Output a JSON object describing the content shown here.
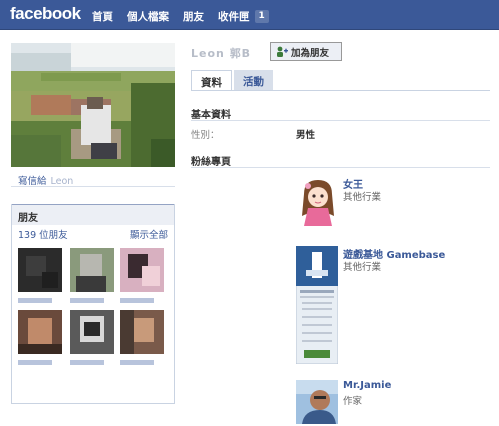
{
  "header": {
    "logo": "facebook",
    "nav": [
      "首頁",
      "個人檔案",
      "朋友",
      "收件匣"
    ],
    "inbox_count": "1"
  },
  "sidebar": {
    "send_message": "寫信給",
    "send_message_name": "Leon",
    "friends_title": "朋友",
    "friends_count": "139 位朋友",
    "show_all": "顯示全部"
  },
  "profile": {
    "name": "Leon 郭B",
    "add_friend": "加為朋友",
    "tabs": [
      "資料",
      "活動"
    ]
  },
  "info": {
    "basic_title": "基本資料",
    "gender_label": "性別：",
    "gender_value": "男性",
    "fan_pages_title": "粉絲專頁",
    "pages": [
      {
        "name": "女王",
        "category": "其他行業"
      },
      {
        "name": "遊戲基地 Gamebase",
        "category": "其他行業"
      },
      {
        "name": "Mr.Jamie",
        "category": "作家"
      }
    ]
  },
  "colors": {
    "brand": "#3b5998",
    "tab_bg": "#d8dfea",
    "box_header": "#eceff5"
  }
}
